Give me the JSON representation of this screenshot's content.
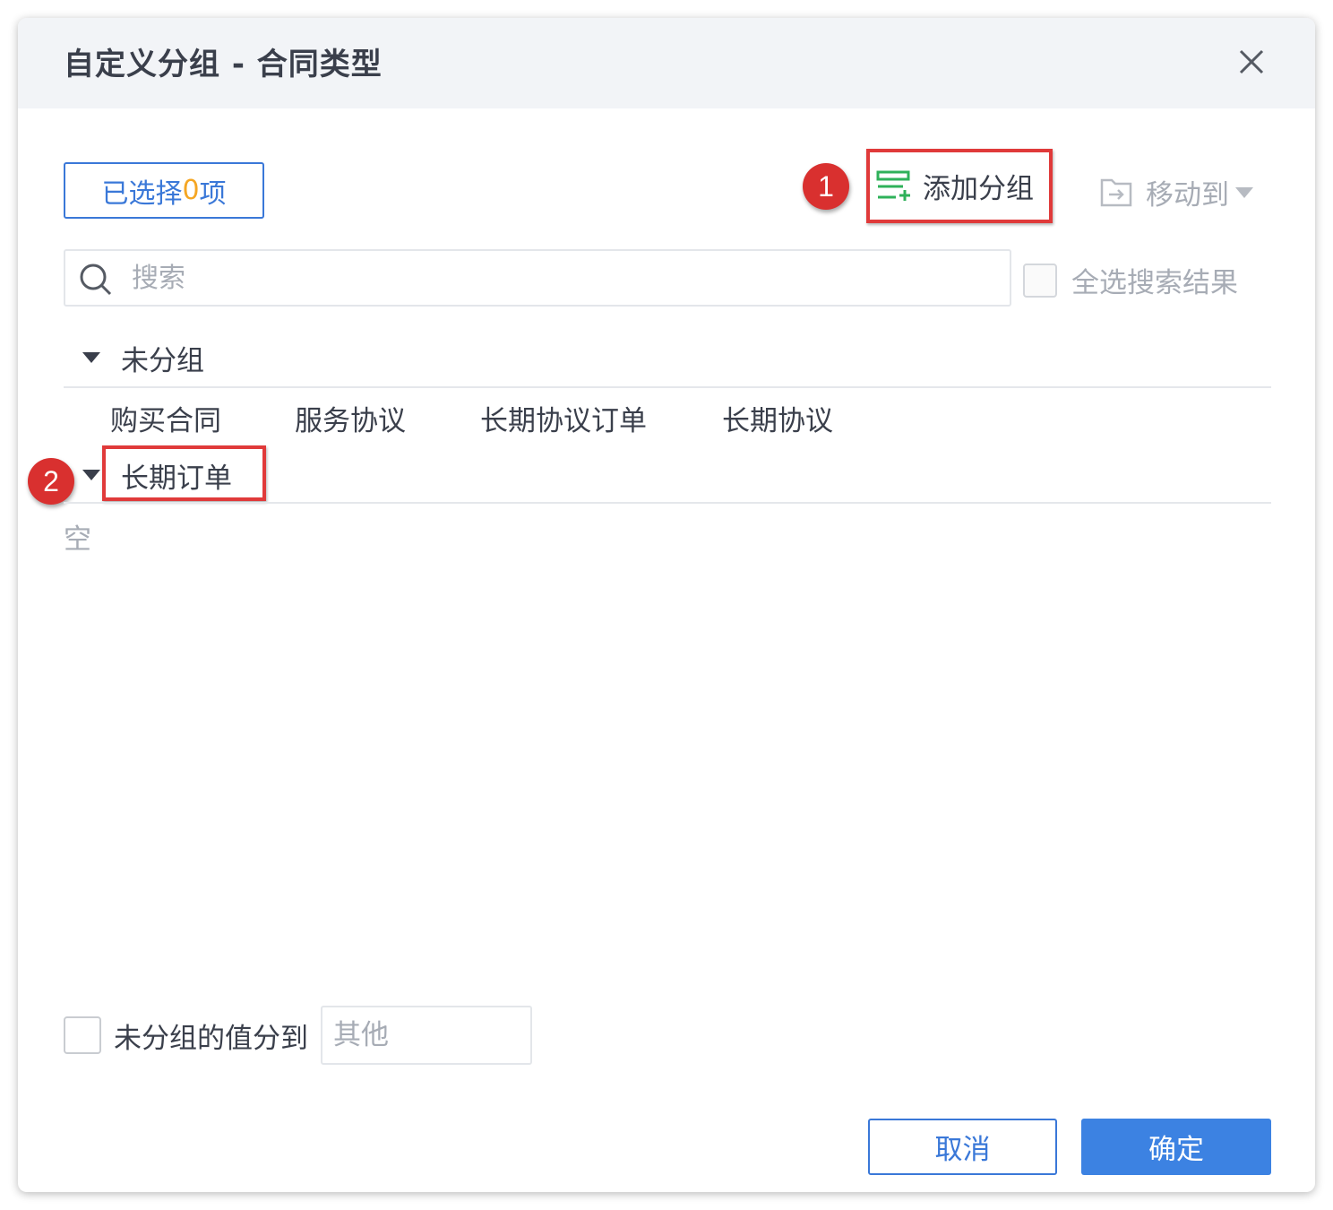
{
  "dialog": {
    "title": "自定义分组 - 合同类型"
  },
  "toolbar": {
    "selected_prefix": "已选择",
    "selected_count": "0",
    "selected_suffix": "项",
    "add_group_label": "添加分组",
    "move_to_label": "移动到"
  },
  "search": {
    "placeholder": "搜索",
    "select_all_label": "全选搜索结果"
  },
  "groups": [
    {
      "name": "未分组",
      "items": [
        "购买合同",
        "服务协议",
        "长期协议订单",
        "长期协议"
      ]
    },
    {
      "name": "长期订单",
      "empty_text": "空"
    }
  ],
  "footer": {
    "ungrouped_label": "未分组的值分到",
    "ungrouped_placeholder": "其他",
    "cancel_label": "取消",
    "ok_label": "确定"
  },
  "callouts": [
    "1",
    "2"
  ],
  "colors": {
    "accent": "#3a78d8",
    "primary_button": "#3c82e2",
    "highlight_count": "#f5a623",
    "add_icon": "#2fb15a",
    "callout_red": "#d9302f"
  },
  "icons": {
    "close": "close-icon",
    "add_group": "add-group-icon",
    "move_to": "move-to-icon",
    "search": "search-icon",
    "caret": "caret-down-icon"
  }
}
